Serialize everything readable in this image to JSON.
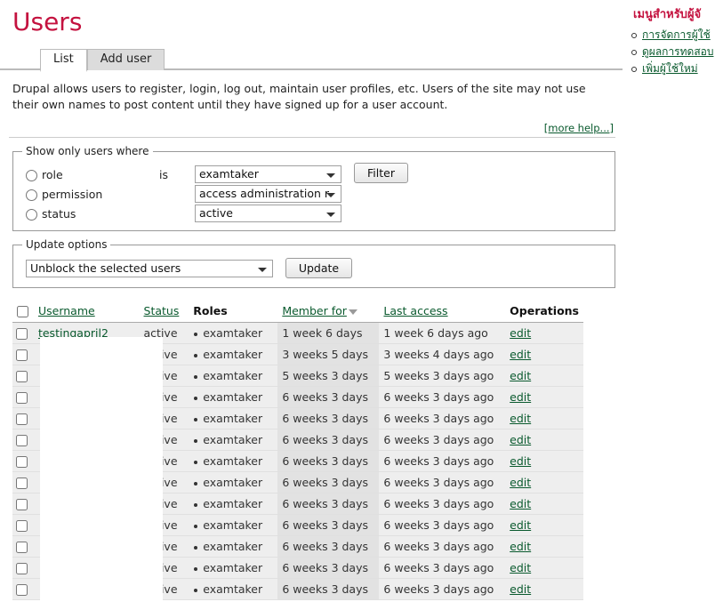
{
  "page": {
    "title": "Users",
    "description": "Drupal allows users to register, login, log out, maintain user profiles, etc. Users of the site may not use their own names to post content until they have signed up for a user account.",
    "more_help": "[more help...]"
  },
  "tabs": [
    {
      "label": "List",
      "active": true
    },
    {
      "label": "Add user",
      "active": false
    }
  ],
  "filter": {
    "legend": "Show only users where",
    "is_label": "is",
    "rows": [
      {
        "label": "role",
        "value": "examtaker",
        "checked": false
      },
      {
        "label": "permission",
        "value": "access administration r",
        "checked": false
      },
      {
        "label": "status",
        "value": "active",
        "checked": false
      }
    ],
    "submit_label": "Filter"
  },
  "update": {
    "legend": "Update options",
    "value": "Unblock the selected users",
    "submit_label": "Update"
  },
  "table": {
    "columns": [
      {
        "key": "check",
        "label": "",
        "sortable": false
      },
      {
        "key": "username",
        "label": "Username",
        "sortable": true
      },
      {
        "key": "status",
        "label": "Status",
        "sortable": true
      },
      {
        "key": "roles",
        "label": "Roles",
        "sortable": false
      },
      {
        "key": "member_for",
        "label": "Member for",
        "sortable": true,
        "sorted": true
      },
      {
        "key": "last_access",
        "label": "Last access",
        "sortable": true
      },
      {
        "key": "operations",
        "label": "Operations",
        "sortable": false
      }
    ],
    "operation_label": "edit",
    "rows": [
      {
        "username": "testingapril2",
        "status": "active",
        "roles": "examtaker",
        "member_for": "1 week 6 days",
        "last_access": "1 week 6 days ago"
      },
      {
        "username": "",
        "status": "active",
        "roles": "examtaker",
        "member_for": "3 weeks 5 days",
        "last_access": "3 weeks 4 days ago"
      },
      {
        "username": "",
        "status": "active",
        "roles": "examtaker",
        "member_for": "5 weeks 3 days",
        "last_access": "5 weeks 3 days ago"
      },
      {
        "username": "",
        "status": "active",
        "roles": "examtaker",
        "member_for": "6 weeks 3 days",
        "last_access": "6 weeks 3 days ago"
      },
      {
        "username": "",
        "status": "active",
        "roles": "examtaker",
        "member_for": "6 weeks 3 days",
        "last_access": "6 weeks 3 days ago"
      },
      {
        "username": "",
        "status": "active",
        "roles": "examtaker",
        "member_for": "6 weeks 3 days",
        "last_access": "6 weeks 3 days ago"
      },
      {
        "username": "",
        "status": "active",
        "roles": "examtaker",
        "member_for": "6 weeks 3 days",
        "last_access": "6 weeks 3 days ago"
      },
      {
        "username": "",
        "status": "active",
        "roles": "examtaker",
        "member_for": "6 weeks 3 days",
        "last_access": "6 weeks 3 days ago"
      },
      {
        "username": "",
        "status": "active",
        "roles": "examtaker",
        "member_for": "6 weeks 3 days",
        "last_access": "6 weeks 3 days ago"
      },
      {
        "username": "",
        "status": "active",
        "roles": "examtaker",
        "member_for": "6 weeks 3 days",
        "last_access": "6 weeks 3 days ago"
      },
      {
        "username": "",
        "status": "active",
        "roles": "examtaker",
        "member_for": "6 weeks 3 days",
        "last_access": "6 weeks 3 days ago"
      },
      {
        "username": "",
        "status": "active",
        "roles": "examtaker",
        "member_for": "6 weeks 3 days",
        "last_access": "6 weeks 3 days ago"
      },
      {
        "username": "",
        "status": "active",
        "roles": "examtaker",
        "member_for": "6 weeks 3 days",
        "last_access": "6 weeks 3 days ago"
      }
    ]
  },
  "right_menu": {
    "title": "เมนูสำหรับผู้จั",
    "items": [
      {
        "label": "การจัดการผู้ใช้"
      },
      {
        "label": "ดูผลการทดสอบ"
      },
      {
        "label": "เพิ่มผู้ใช้ใหม่"
      }
    ]
  },
  "colors": {
    "title": "#c4123f",
    "link": "#0a5a2e",
    "row_bg": "#eeeeee",
    "sorted_col_bg": "#e2e2e2"
  }
}
